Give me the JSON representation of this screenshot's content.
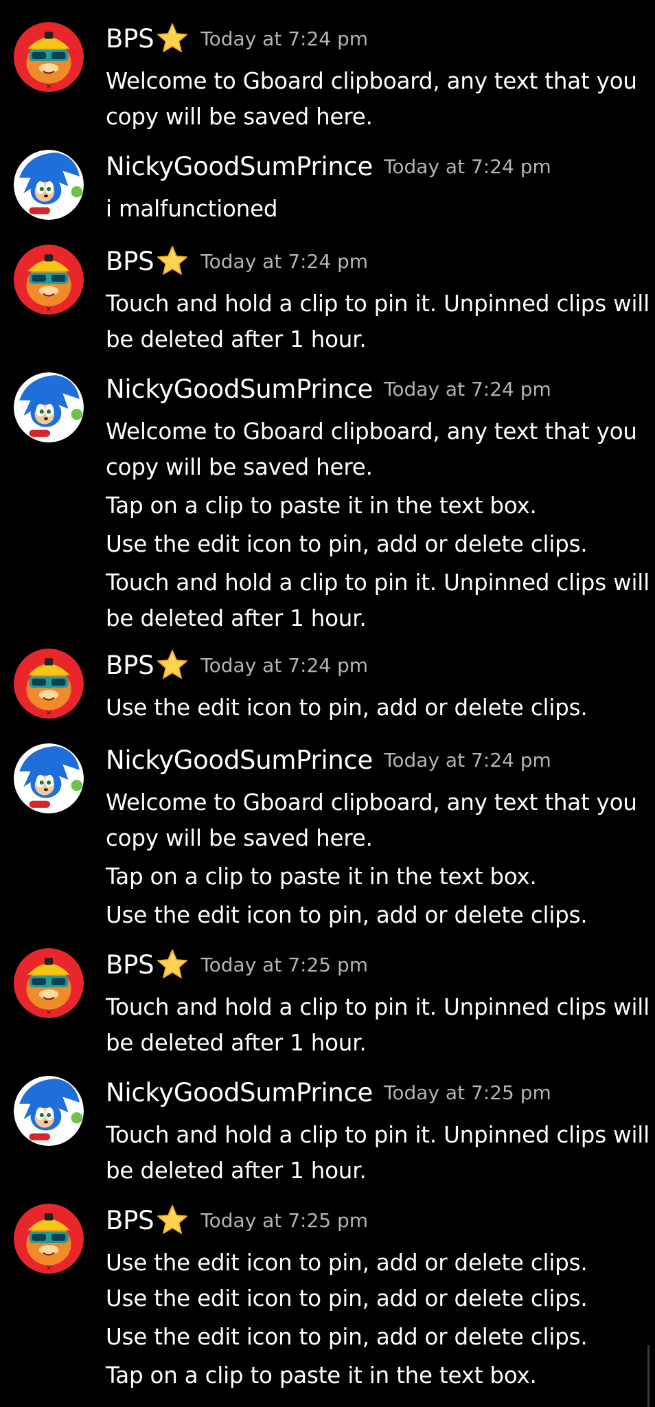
{
  "colors": {
    "background": "#000000",
    "username": "#ffffff",
    "timestamp": "#b3b3b8",
    "text": "#ffffff",
    "bps_avatar_bg": "#e8262b",
    "sonic_avatar_bg": "#1e6fd9"
  },
  "messages": [
    {
      "author": "BPS",
      "avatar_icon": "bps-avatar-icon",
      "badge_icon": "star-icon",
      "timestamp": "Today at 7:24 pm",
      "lines": [
        "Welcome to Gboard clipboard, any text that you",
        "copy will be saved here."
      ]
    },
    {
      "author": "NickyGoodSumPrince",
      "avatar_icon": "sonic-avatar-icon",
      "timestamp": "Today at 7:24 pm",
      "lines": [
        "i malfunctioned"
      ]
    },
    {
      "author": "BPS",
      "avatar_icon": "bps-avatar-icon",
      "badge_icon": "star-icon",
      "timestamp": "Today at 7:24 pm",
      "lines": [
        "Touch and hold a clip to pin it. Unpinned clips will",
        "be deleted after 1 hour."
      ]
    },
    {
      "author": "NickyGoodSumPrince",
      "avatar_icon": "sonic-avatar-icon",
      "timestamp": "Today at 7:24 pm",
      "lines": [
        "Welcome to Gboard clipboard, any text that you",
        "copy will be saved here.",
        "Tap on a clip to paste it in the text box.",
        "Use the edit icon to pin, add or delete clips.",
        "Touch and hold a clip to pin it. Unpinned clips will",
        "be deleted after 1 hour."
      ]
    },
    {
      "author": "BPS",
      "avatar_icon": "bps-avatar-icon",
      "badge_icon": "star-icon",
      "timestamp": "Today at 7:24 pm",
      "lines": [
        "Use the edit icon to pin, add or delete clips."
      ]
    },
    {
      "author": "NickyGoodSumPrince",
      "avatar_icon": "sonic-avatar-icon",
      "timestamp": "Today at 7:24 pm",
      "lines": [
        "Welcome to Gboard clipboard, any text that you",
        "copy will be saved here.",
        "Tap on a clip to paste it in the text box.",
        "Use the edit icon to pin, add or delete clips."
      ]
    },
    {
      "author": "BPS",
      "avatar_icon": "bps-avatar-icon",
      "badge_icon": "star-icon",
      "timestamp": "Today at 7:25 pm",
      "lines": [
        "Touch and hold a clip to pin it. Unpinned clips will",
        "be deleted after 1 hour."
      ]
    },
    {
      "author": "NickyGoodSumPrince",
      "avatar_icon": "sonic-avatar-icon",
      "timestamp": "Today at 7:25 pm",
      "lines": [
        "Touch and hold a clip to pin it. Unpinned clips will",
        "be deleted after 1 hour."
      ]
    },
    {
      "author": "BPS",
      "avatar_icon": "bps-avatar-icon",
      "badge_icon": "star-icon",
      "timestamp": "Today at 7:25 pm",
      "lines": [
        "Use the edit icon to pin, add or delete clips.",
        "Use the edit icon to pin, add or delete clips.",
        "Use the edit icon to pin, add or delete clips.",
        "Tap on a clip to paste it in the text box."
      ]
    }
  ]
}
